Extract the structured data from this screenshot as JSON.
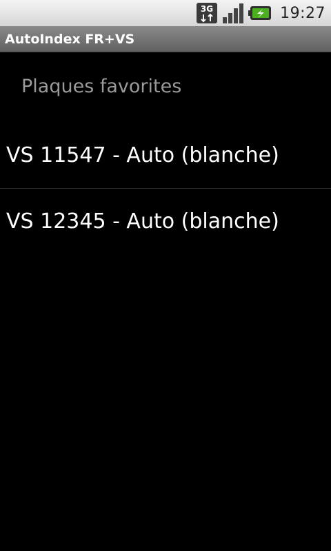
{
  "status_bar": {
    "network_type": "3G",
    "time": "19:27",
    "icons": [
      "network-3g-icon",
      "signal-strength-icon",
      "battery-charging-icon"
    ]
  },
  "app": {
    "title": "AutoIndex FR+VS"
  },
  "favorites": {
    "header": "Plaques favorites",
    "items": [
      {
        "label": "VS 11547 - Auto (blanche)"
      },
      {
        "label": "VS 12345 - Auto (blanche)"
      }
    ]
  }
}
